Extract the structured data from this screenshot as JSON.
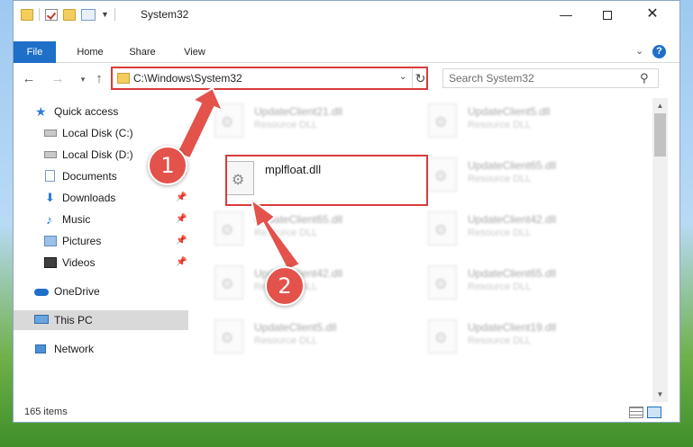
{
  "window": {
    "title": "System32",
    "controls": {
      "minimize": "—",
      "restore": "☐",
      "close": "✕"
    }
  },
  "ribbon": {
    "tabs": [
      "File",
      "Home",
      "Share",
      "View"
    ],
    "expand_icon": "chevron-down-icon",
    "help_label": "?"
  },
  "nav": {
    "address_path": "C:\\Windows\\System32",
    "search_placeholder": "Search System32"
  },
  "sidebar": {
    "items": [
      {
        "label": "Quick access",
        "icon": "star-icon",
        "pinned": false
      },
      {
        "label": "Local Disk (C:)",
        "icon": "disk-icon",
        "pinned": false
      },
      {
        "label": "Local Disk (D:)",
        "icon": "disk-icon",
        "pinned": false
      },
      {
        "label": "Documents",
        "icon": "documents-icon",
        "pinned": true
      },
      {
        "label": "Downloads",
        "icon": "download-icon",
        "pinned": true
      },
      {
        "label": "Music",
        "icon": "music-icon",
        "pinned": true
      },
      {
        "label": "Pictures",
        "icon": "pictures-icon",
        "pinned": true
      },
      {
        "label": "Videos",
        "icon": "videos-icon",
        "pinned": true
      },
      {
        "label": "OneDrive",
        "icon": "cloud-icon",
        "pinned": false
      },
      {
        "label": "This PC",
        "icon": "computer-icon",
        "pinned": false,
        "selected": true
      },
      {
        "label": "Network",
        "icon": "network-icon",
        "pinned": false
      }
    ]
  },
  "files": [
    {
      "name": "UpdateClient21.dll",
      "type": "Resource DLL",
      "blurred": true
    },
    {
      "name": "UpdateClient5.dll",
      "type": "Resource DLL",
      "blurred": true
    },
    {
      "name": "mplfloat.dll",
      "type": "",
      "blurred": false,
      "highlighted": true
    },
    {
      "name": "UpdateClient65.dll",
      "type": "Resource DLL",
      "blurred": true
    },
    {
      "name": "UpdateClient65.dll",
      "type": "Resource DLL",
      "blurred": true
    },
    {
      "name": "UpdateClient42.dll",
      "type": "Resource DLL",
      "blurred": true
    },
    {
      "name": "UpdateClient42.dll",
      "type": "Resource DLL",
      "blurred": true
    },
    {
      "name": "UpdateClient65.dll",
      "type": "Resource DLL",
      "blurred": true
    },
    {
      "name": "UpdateClient5.dll",
      "type": "Resource DLL",
      "blurred": true
    },
    {
      "name": "UpdateClient19.dll",
      "type": "Resource DLL",
      "blurred": true
    }
  ],
  "status": {
    "item_count": "165 items"
  },
  "annotations": {
    "badge_1": "1",
    "badge_2": "2",
    "accent_color": "#e4524c"
  }
}
